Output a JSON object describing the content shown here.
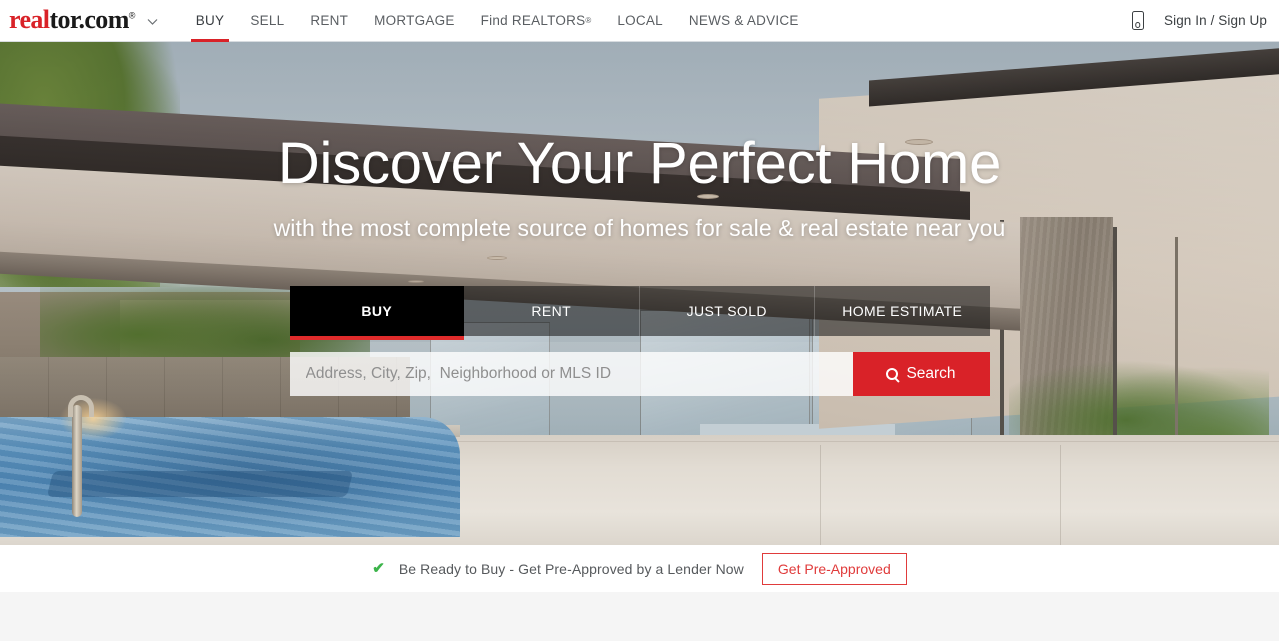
{
  "header": {
    "logo": {
      "part_red": "real",
      "part_black": "tor.com",
      "registered": "®",
      "caret_icon": "chevron-down-icon"
    },
    "nav": [
      {
        "label": "BUY",
        "active": true
      },
      {
        "label": "SELL",
        "active": false
      },
      {
        "label": "RENT",
        "active": false
      },
      {
        "label": "MORTGAGE",
        "active": false
      },
      {
        "label": "Find REALTORS",
        "sup": "®",
        "active": false
      },
      {
        "label": "LOCAL",
        "active": false
      },
      {
        "label": "NEWS & ADVICE",
        "active": false
      }
    ],
    "phone_icon": "mobile-phone-icon",
    "signin_label": "Sign In / Sign Up",
    "accent_red": "#d92228",
    "underline_color": "#d92228"
  },
  "hero": {
    "title": "Discover Your Perfect Home",
    "subtitle": "with the most complete source of homes for sale & real estate near you",
    "tabs": [
      {
        "label": "BUY",
        "active": true
      },
      {
        "label": "RENT",
        "active": false
      },
      {
        "label": "JUST SOLD",
        "active": false
      },
      {
        "label": "HOME ESTIMATE",
        "active": false
      }
    ],
    "search": {
      "placeholder": "Address, City, Zip,  Neighborhood or MLS ID",
      "value": "",
      "button_label": "Search",
      "button_icon": "search-icon",
      "button_color": "#d92228"
    },
    "active_tab_underline": "#e02b2b"
  },
  "cta": {
    "check_icon": "✔",
    "check_color": "#3cb44a",
    "text": "Be Ready to Buy - Get Pre-Approved by a Lender Now",
    "button_label": "Get Pre-Approved",
    "button_color": "#e03b3b"
  }
}
